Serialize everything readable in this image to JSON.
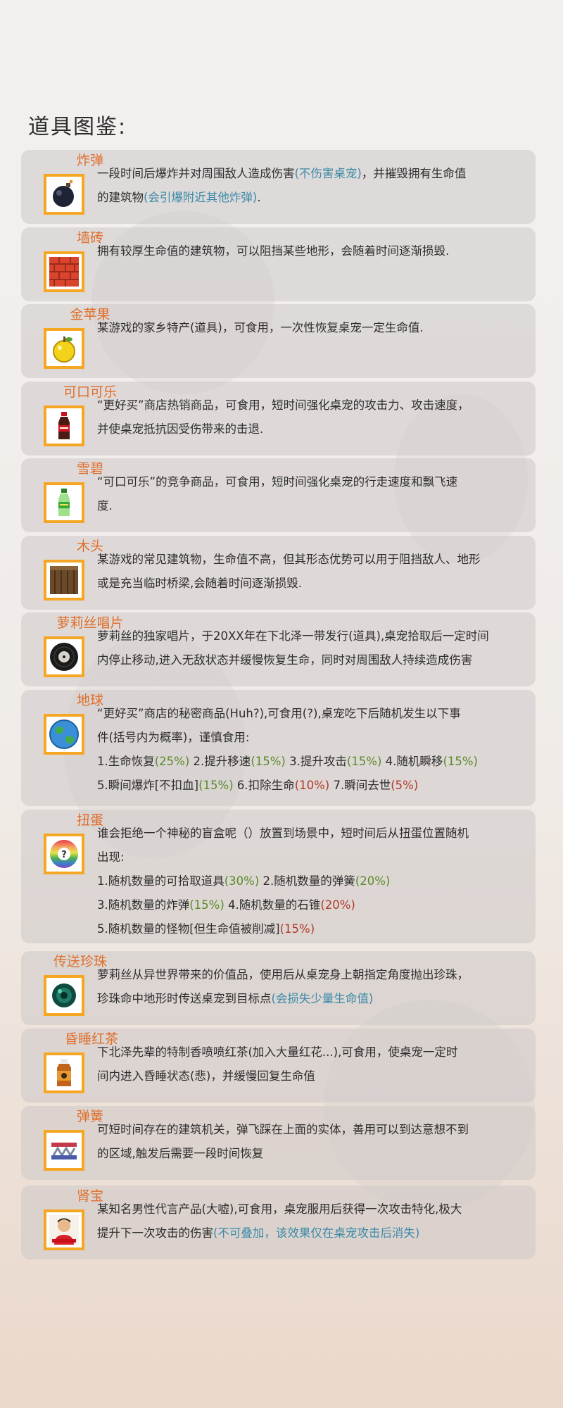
{
  "page": {
    "title": "道具图鉴:"
  },
  "colors": {
    "item_name": "#df6e2a",
    "icon_border": "#f5a623",
    "note_blue": "#3d8ba8",
    "pct_green": "#5a8a2a",
    "pct_red": "#b23a2a",
    "card_bg": "#cdc9c9"
  },
  "items": [
    {
      "name": "炸弹",
      "icon": "bomb-icon",
      "lines": [
        [
          {
            "t": "一段时间后爆炸并对周围敌人造成伤害"
          },
          {
            "t": "(不伤害桌宠)",
            "c": "blue"
          },
          {
            "t": "，并摧毁拥有生命值"
          }
        ],
        [
          {
            "t": "的建筑物"
          },
          {
            "t": "(会引爆附近其他炸弹)",
            "c": "blue"
          },
          {
            "t": "."
          }
        ]
      ]
    },
    {
      "name": "墙砖",
      "icon": "brick-wall-icon",
      "lines": [
        [
          {
            "t": "拥有较厚生命值的建筑物，可以阻挡某些地形，会随着时间逐渐损毁."
          }
        ]
      ]
    },
    {
      "name": "金苹果",
      "icon": "golden-apple-icon",
      "lines": [
        [
          {
            "t": "某游戏的家乡特产(道具)，可食用，一次性恢复桌宠一定生命值."
          }
        ]
      ]
    },
    {
      "name": "可口可乐",
      "icon": "cola-bottle-icon",
      "lines": [
        [
          {
            "t": "“更好买”商店热销商品，可食用，短时间强化桌宠的攻击力、攻击速度，"
          }
        ],
        [
          {
            "t": "并使桌宠抵抗因受伤带来的击退."
          }
        ]
      ]
    },
    {
      "name": "雪碧",
      "icon": "sprite-bottle-icon",
      "lines": [
        [
          {
            "t": "“可口可乐”的竞争商品，可食用，短时间强化桌宠的行走速度和飘飞速"
          }
        ],
        [
          {
            "t": "度."
          }
        ]
      ]
    },
    {
      "name": "木头",
      "icon": "wood-block-icon",
      "lines": [
        [
          {
            "t": "某游戏的常见建筑物，生命值不高，但其形态优势可以用于阻挡敌人、地形"
          }
        ],
        [
          {
            "t": "或是充当临时桥梁,会随着时间逐渐损毁."
          }
        ]
      ]
    },
    {
      "name": "萝莉丝唱片",
      "icon": "vinyl-record-icon",
      "lines": [
        [
          {
            "t": "萝莉丝的独家唱片，于20XX年在下北泽一带发行(道具),桌宠拾取后一定时间"
          }
        ],
        [
          {
            "t": "内停止移动,进入无敌状态并缓慢恢复生命，同时对周围敌人持续造成伤害"
          }
        ]
      ]
    },
    {
      "name": "地球",
      "icon": "earth-globe-icon",
      "lines": [
        [
          {
            "t": "“更好买”商店的秘密商品(Huh?),可食用(?),桌宠吃下后随机发生以下事"
          }
        ],
        [
          {
            "t": "件(括号内为概率)，谨慎食用:"
          }
        ],
        [
          {
            "t": "1.生命恢复"
          },
          {
            "t": "(25%)",
            "c": "green"
          },
          {
            "t": "   2.提升移速"
          },
          {
            "t": "(15%)",
            "c": "green"
          },
          {
            "t": "   3.提升攻击"
          },
          {
            "t": "(15%)",
            "c": "green"
          },
          {
            "t": "   4.随机瞬移"
          },
          {
            "t": "(15%)",
            "c": "green"
          }
        ],
        [
          {
            "t": "5.瞬间爆炸[不扣血]"
          },
          {
            "t": "(15%)",
            "c": "green"
          },
          {
            "t": "     6.扣除生命"
          },
          {
            "t": "(10%)",
            "c": "red"
          },
          {
            "t": "     7.瞬间去世"
          },
          {
            "t": "(5%)",
            "c": "red"
          }
        ]
      ]
    },
    {
      "name": "扭蛋",
      "icon": "gacha-capsule-icon",
      "lines": [
        [
          {
            "t": "谁会拒绝一个神秘的盲盒呢（）放置到场景中，短时间后从扭蛋位置随机"
          }
        ],
        [
          {
            "t": "出现:"
          }
        ],
        [
          {
            "t": "1.随机数量的可拾取道具"
          },
          {
            "t": "(30%)",
            "c": "green"
          },
          {
            "t": "   2.随机数量的弹簧"
          },
          {
            "t": "(20%)",
            "c": "green"
          }
        ],
        [
          {
            "t": "3.随机数量的炸弹"
          },
          {
            "t": "(15%)",
            "c": "green"
          },
          {
            "t": "      4.随机数量的石锥"
          },
          {
            "t": "(20%)",
            "c": "red"
          }
        ],
        [
          {
            "t": "5.随机数量的怪物[但生命值被削减]"
          },
          {
            "t": "(15%)",
            "c": "red"
          }
        ]
      ]
    },
    {
      "name": "传送珍珠",
      "icon": "ender-pearl-icon",
      "lines": [
        [
          {
            "t": "萝莉丝从异世界带来的价值品，使用后从桌宠身上朝指定角度抛出珍珠，"
          }
        ],
        [
          {
            "t": "珍珠命中地形时传送桌宠到目标点"
          },
          {
            "t": "(会损失少量生命值)",
            "c": "blue"
          }
        ]
      ]
    },
    {
      "name": "昏睡红茶",
      "icon": "tea-bottle-icon",
      "lines": [
        [
          {
            "t": "下北泽先辈的特制香喷喷红茶(加入大量红花...),可食用，使桌宠一定时"
          }
        ],
        [
          {
            "t": "间内进入昏睡状态(悲)，并缓慢回复生命值"
          }
        ]
      ]
    },
    {
      "name": "弹簧",
      "icon": "spring-pad-icon",
      "lines": [
        [
          {
            "t": "可短时间存在的建筑机关，弹飞踩在上面的实体，善用可以到达意想不到"
          }
        ],
        [
          {
            "t": "的区域,触发后需要一段时间恢复"
          }
        ]
      ]
    },
    {
      "name": "肾宝",
      "icon": "spokesman-portrait-icon",
      "lines": [
        [
          {
            "t": "某知名男性代言产品(大嘘),可食用，桌宠服用后获得一次攻击特化,极大"
          }
        ],
        [
          {
            "t": "提升下一次攻击的伤害"
          },
          {
            "t": "(不可叠加，该效果仅在桌宠攻击后消失)",
            "c": "blue"
          }
        ]
      ]
    }
  ]
}
